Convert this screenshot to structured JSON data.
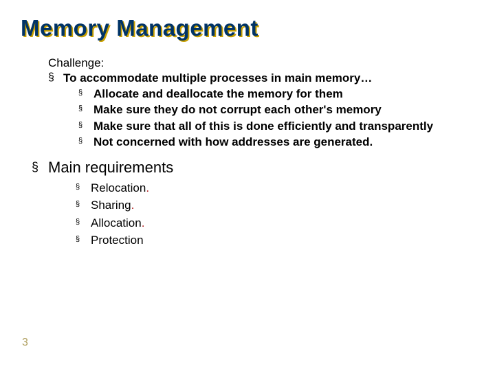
{
  "title": "Memory Management",
  "lead": "Challenge:",
  "l1_item": "To accommodate multiple processes in main memory…",
  "l2": [
    "Allocate and deallocate the memory for them",
    "Make sure they do not corrupt each other's memory",
    "Make sure that all of this is done efficiently and transparently",
    "Not concerned with how addresses are generated."
  ],
  "section": "Main requirements",
  "l3": [
    {
      "text": "Relocation",
      "dot": "."
    },
    {
      "text": "Sharing",
      "dot": "."
    },
    {
      "text": "Allocation",
      "dot": "."
    },
    {
      "text": "Protection",
      "dot": ""
    }
  ],
  "page": "3"
}
